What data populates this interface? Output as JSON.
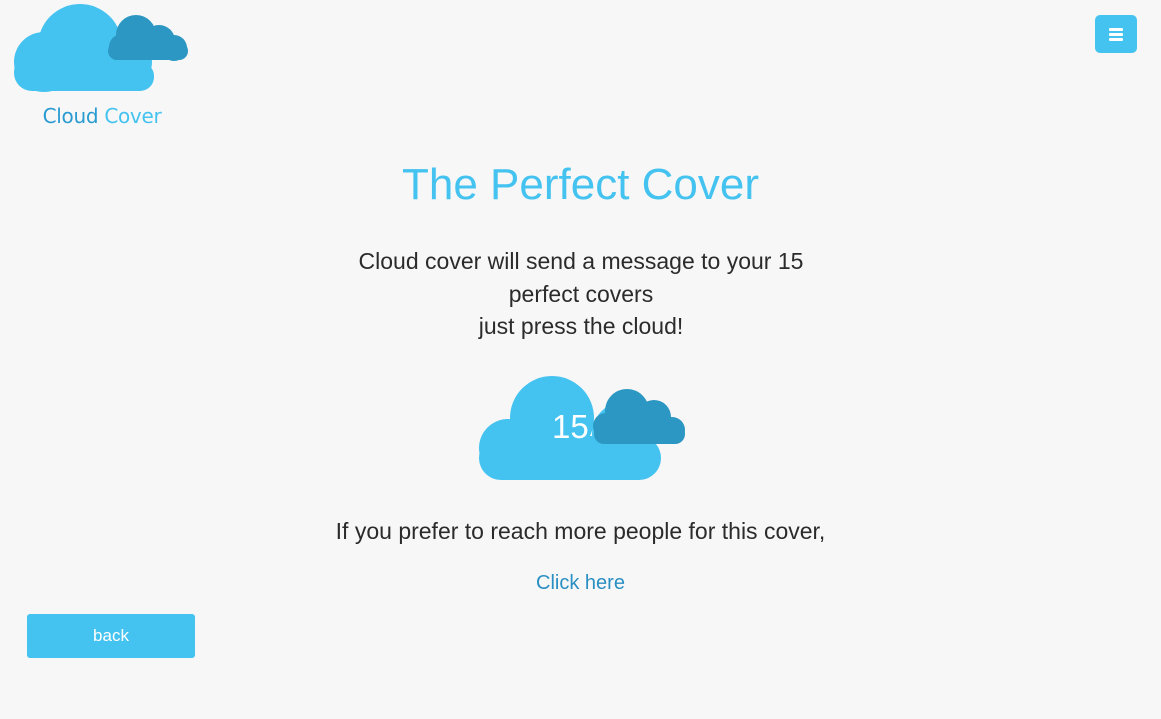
{
  "header": {
    "logo_word_1": "Cloud",
    "logo_word_2": "Cover",
    "menu_icon": "hamburger-icon"
  },
  "main": {
    "title": "The Perfect Cover",
    "message_line_1": "Cloud cover will send a message to your 15",
    "message_line_2": "perfect covers",
    "message_line_3": "just press the cloud!",
    "cloud_count": "15",
    "prefer_text": "If you prefer to reach more people for this cover,",
    "click_here": "Click here"
  },
  "footer": {
    "back_label": "back"
  },
  "colors": {
    "accent_light": "#45c3f0",
    "accent_dark": "#2a9bd1",
    "cloud_dark": "#2b97c2",
    "background": "#f7f7f7",
    "text": "#2b2b2b"
  }
}
